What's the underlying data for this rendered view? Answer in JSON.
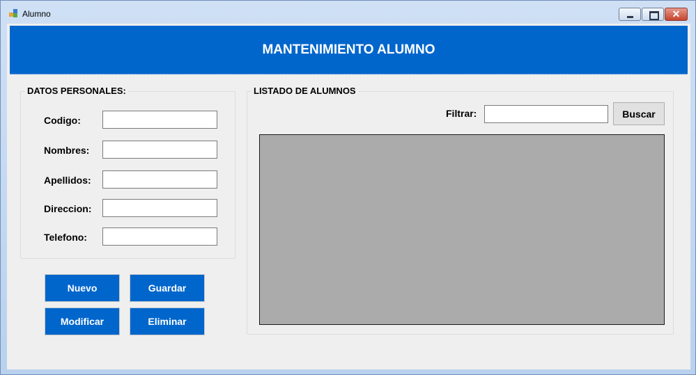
{
  "window": {
    "title": "Alumno",
    "controls": {
      "minimize": "",
      "maximize": "",
      "close": "✕"
    }
  },
  "banner": {
    "title": "MANTENIMIENTO ALUMNO",
    "color": "#0066cc"
  },
  "datos": {
    "caption": "DATOS PERSONALES:",
    "fields": [
      {
        "label": "Codigo:",
        "value": ""
      },
      {
        "label": "Nombres:",
        "value": ""
      },
      {
        "label": "Apellidos:",
        "value": ""
      },
      {
        "label": "Direccion:",
        "value": ""
      },
      {
        "label": "Telefono:",
        "value": ""
      }
    ]
  },
  "actions": {
    "nuevo": "Nuevo",
    "guardar": "Guardar",
    "modificar": "Modificar",
    "eliminar": "Eliminar"
  },
  "listado": {
    "caption": "LISTADO DE ALUMNOS",
    "filter_label": "Filtrar:",
    "filter_value": "",
    "search_button": "Buscar"
  },
  "icons": {
    "app": "app-window-icon",
    "minimize": "minimize-icon",
    "maximize": "maximize-icon",
    "close": "close-icon"
  }
}
